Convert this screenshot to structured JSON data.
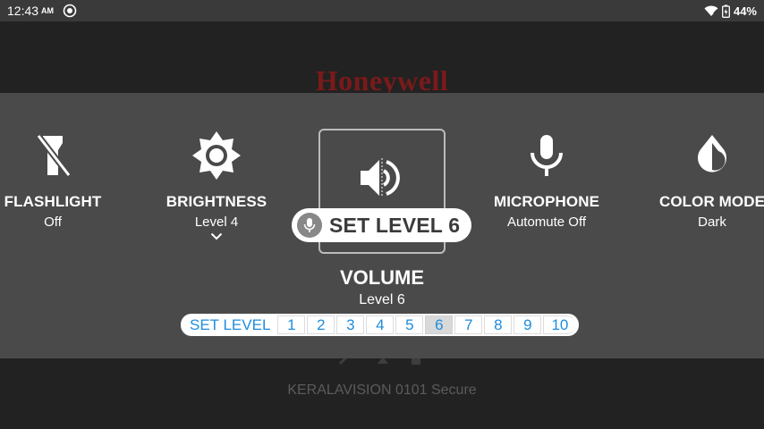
{
  "status_bar": {
    "time": "12:43",
    "ampm": "AM",
    "battery": "44%"
  },
  "background": {
    "logo": "Honeywell",
    "network_text": "KERALAVISION 0101 Secure"
  },
  "tiles": {
    "flashlight": {
      "label": "FLASHLIGHT",
      "value": "Off"
    },
    "brightness": {
      "label": "BRIGHTNESS",
      "value": "Level 4"
    },
    "volume": {
      "label": "VOLUME",
      "value": "Level 6"
    },
    "microphone": {
      "label": "MICROPHONE",
      "value": "Automute Off"
    },
    "color_mode": {
      "label": "COLOR MODE",
      "value": "Dark"
    }
  },
  "voice_command": {
    "text": "SET LEVEL 6"
  },
  "level_selector": {
    "label": "SET LEVEL",
    "levels": [
      "1",
      "2",
      "3",
      "4",
      "5",
      "6",
      "7",
      "8",
      "9",
      "10"
    ],
    "selected": "6"
  },
  "colors": {
    "panel_bg": "#4a4a4a",
    "accent_blue": "#1f8ddc",
    "status_bar_bg": "#3a3a3a"
  }
}
